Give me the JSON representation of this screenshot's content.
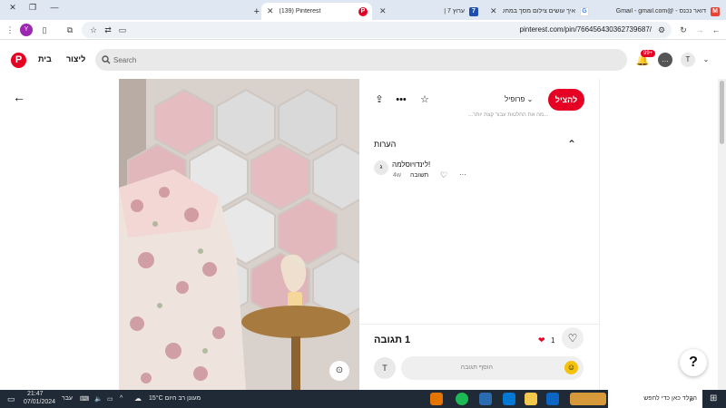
{
  "browser": {
    "tabs": [
      {
        "title": "דואר נכנס - Gmail - ‎‫@gmail.com‬‏",
        "favicon": "gmail-icon"
      },
      {
        "title": "איך עושים צילום מסך במחשב -",
        "favicon": "google-icon"
      },
      {
        "title": "ערוץ 7 |",
        "favicon": "channel7-icon"
      },
      {
        "title": "(139) Pinterest",
        "favicon": "pinterest-icon",
        "active": true
      }
    ],
    "new_tab": "+",
    "url": "pinterest.com/pin/766456430362739687/"
  },
  "header": {
    "home": "בית",
    "create": "ליצור",
    "search_placeholder": "Search",
    "notifications_badge": "99+",
    "avatar_letter": "T"
  },
  "pin": {
    "save_label": "להציל",
    "profile_label": "פרופיל",
    "partial_text": "...מה את החלטות עבור קצת יותר...",
    "comments_heading": "הערות",
    "comment": {
      "avatar_letter": "ג",
      "text": "!לינדויוסלמה",
      "age": "4w",
      "reply": "תשובה"
    },
    "responses_label": "1 תגובה",
    "hearts_count": "1",
    "comment_placeholder": "הוסף תגובה",
    "user_letter": "T"
  },
  "help_label": "?",
  "taskbar": {
    "search_placeholder": "הקלד כאן כדי לחפש",
    "weather": "מעונן רב היום  15°C",
    "language": "עבר",
    "time": "21:47",
    "date": "07/01/2024"
  },
  "colors": {
    "pinterest_red": "#e60023",
    "taskbar": "#1f2a36",
    "tabstrip": "#dfe7f2"
  }
}
